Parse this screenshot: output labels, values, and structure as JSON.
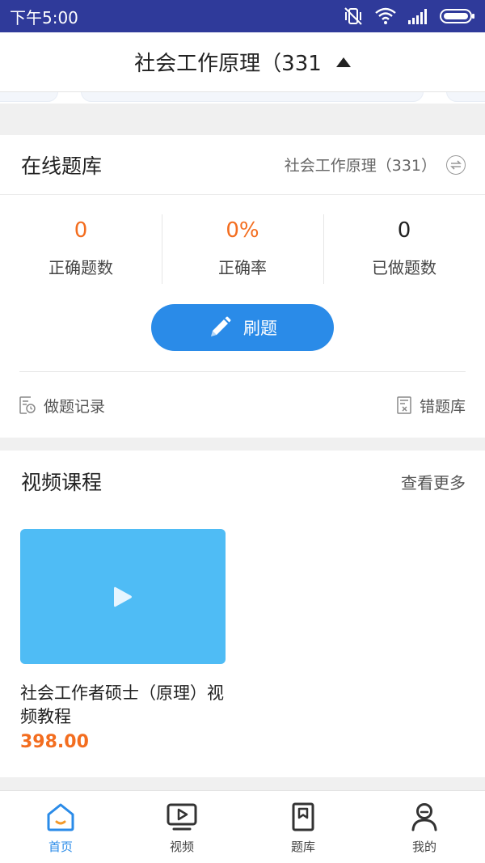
{
  "status_bar": {
    "time": "下午5:00"
  },
  "header": {
    "title": "社会工作原理（331"
  },
  "question_bank": {
    "title": "在线题库",
    "subject": "社会工作原理（331）",
    "stats": [
      {
        "value": "0",
        "label": "正确题数"
      },
      {
        "value": "0%",
        "label": "正确率"
      },
      {
        "value": "0",
        "label": "已做题数"
      }
    ],
    "practice_button": "刷题",
    "records_link": "做题记录",
    "wrong_link": "错题库"
  },
  "video_section": {
    "title": "视频课程",
    "more_link": "查看更多",
    "courses": [
      {
        "title": "社会工作者硕士（原理）视频教程",
        "price": "398.00"
      }
    ]
  },
  "bottom_nav": {
    "items": [
      {
        "label": "首页"
      },
      {
        "label": "视频"
      },
      {
        "label": "题库"
      },
      {
        "label": "我的"
      }
    ],
    "active_index": 0
  },
  "colors": {
    "status_bar": "#2f3a9a",
    "accent": "#2a8be8",
    "price": "#f36d1f",
    "thumbnail": "#4fbcf5"
  }
}
